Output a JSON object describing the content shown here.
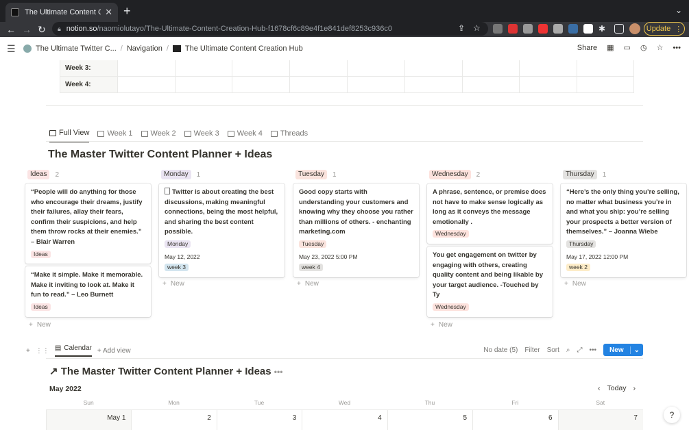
{
  "browser": {
    "tab_title": "The Ultimate Content Creation",
    "url_host": "notion.so",
    "url_path": "/naomiolutayo/The-Ultimate-Content-Creation-Hub-f1678cf6c89e4f1e841def8253c936c0",
    "update_label": "Update"
  },
  "topbar": {
    "crumb1": "The Ultimate Twitter C...",
    "crumb2": "Navigation",
    "crumb3": "The Ultimate Content Creation Hub",
    "share": "Share"
  },
  "week_table": {
    "rows": [
      "Week 3:",
      "Week 4:"
    ]
  },
  "views": [
    "Full View",
    "Week 1",
    "Week 2",
    "Week 3",
    "Week 4",
    "Threads"
  ],
  "db_title": "The Master Twitter Content Planner + Ideas",
  "board": {
    "columns": [
      {
        "name": "Ideas",
        "count": "2",
        "color": "#fbe4e4",
        "cards": [
          {
            "text": "“People will do anything for those who encourage their dreams, justify their failures, allay their fears, confirm their suspicions, and help them throw rocks at their enemies.” – Blair Warren",
            "tag": "Ideas"
          },
          {
            "text": "“Make it simple. Make it memorable. Make it inviting to look at. Make it fun to read.” – Leo Burnett",
            "tag": "Ideas"
          }
        ],
        "new": "New"
      },
      {
        "name": "Monday",
        "count": "1",
        "color": "#eae4f2",
        "cards": [
          {
            "text": "Twitter is about creating the best discussions, making meaningful connections, being the most helpful, and sharing the best content possible.",
            "tag": "Monday",
            "date": "May 12, 2022",
            "week": "week 3"
          }
        ],
        "new": "New"
      },
      {
        "name": "Tuesday",
        "count": "1",
        "color": "#fae3dd",
        "cards": [
          {
            "text": "Good copy starts with understanding your customers and knowing why they choose you rather than millions of others. - enchanting marketing.com",
            "tag": "Tuesday",
            "date": "May 23, 2022 5:00 PM",
            "week": "week 4"
          }
        ],
        "new": "New"
      },
      {
        "name": "Wednesday",
        "count": "2",
        "color": "#fde2dd",
        "cards": [
          {
            "text": "A phrase, sentence, or premise does not have to make sense logically as long as it conveys the message emotionally .",
            "tag": "Wednesday"
          },
          {
            "text": "You get engagement on twitter by engaging with others, creating quality content and being likable by your target audience. -Touched by Ty",
            "tag": "Wednesday"
          }
        ],
        "new": "New"
      },
      {
        "name": "Thursday",
        "count": "1",
        "color": "#e3e2e0",
        "cards": [
          {
            "text": "“Here’s the only thing you’re selling, no matter what business you’re in and what you ship: you’re selling your prospects a better version of themselves.” – Joanna Wiebe",
            "tag": "Thursday",
            "date": "May 17, 2022 12:00 PM",
            "week": "week 2"
          }
        ],
        "new": "New"
      }
    ]
  },
  "calendar": {
    "view_label": "Calendar",
    "add_view": "Add view",
    "no_date": "No date (5)",
    "filter": "Filter",
    "sort": "Sort",
    "new": "New",
    "title": "The Master Twitter Content Planner + Ideas",
    "month": "May 2022",
    "today": "Today",
    "dows": [
      "Sun",
      "Mon",
      "Tue",
      "Wed",
      "Thu",
      "Fri",
      "Sat"
    ],
    "days": [
      "May 1",
      "2",
      "3",
      "4",
      "5",
      "6",
      "7"
    ]
  },
  "colors": {
    "tag_monday": "#eae4f2",
    "tag_tuesday": "#fae3dd",
    "week3": "#d3e5ef",
    "week4": "#e3e2e0",
    "week2": "#fdecc8",
    "accent": "#2383e2"
  }
}
